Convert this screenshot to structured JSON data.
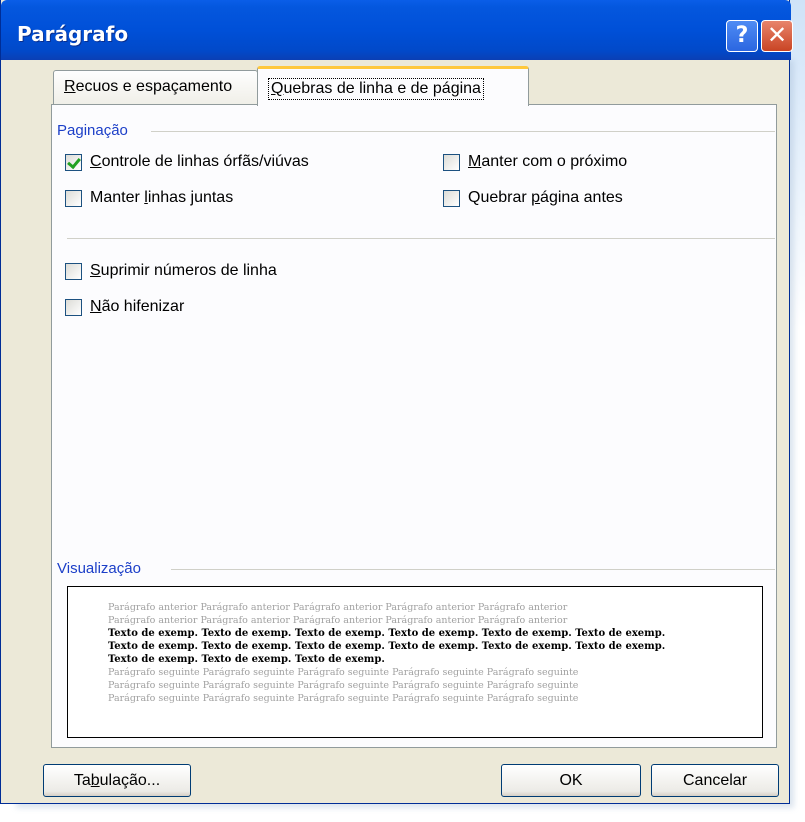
{
  "window": {
    "title": "Parágrafo",
    "help_label": "?",
    "close_label": "✕"
  },
  "tabs": [
    {
      "label_pre": "",
      "label_key": "R",
      "label_post": "ecuos e espaçamento",
      "active": false
    },
    {
      "label_pre": "",
      "label_key": "Q",
      "label_post": "uebras de linha e de página",
      "active": true
    }
  ],
  "pagination": {
    "group_label": "Paginação",
    "options": [
      {
        "pre": "",
        "key": "C",
        "post": "ontrole de linhas órfãs/viúvas",
        "checked": true
      },
      {
        "pre": "",
        "key": "M",
        "post": "anter com o próximo",
        "checked": false
      },
      {
        "pre": "Manter ",
        "key": "l",
        "post": "inhas juntas",
        "checked": false
      },
      {
        "pre": "Quebrar ",
        "key": "p",
        "post": "ágina antes",
        "checked": false
      }
    ]
  },
  "formatting": {
    "options": [
      {
        "pre": "",
        "key": "S",
        "post": "uprimir números de linha",
        "checked": false
      },
      {
        "pre": "",
        "key": "N",
        "post": "ão hifenizar",
        "checked": false
      }
    ]
  },
  "preview": {
    "group_label": "Visualização",
    "lines": [
      {
        "text": "Parágrafo anterior Parágrafo anterior Parágrafo anterior Parágrafo anterior Parágrafo anterior",
        "style": "gray"
      },
      {
        "text": "Parágrafo anterior Parágrafo anterior Parágrafo anterior Parágrafo anterior Parágrafo anterior",
        "style": "gray"
      },
      {
        "text": "Texto de exemp. Texto de exemp. Texto de exemp. Texto de exemp. Texto de exemp. Texto de exemp.",
        "style": "dark"
      },
      {
        "text": "Texto de exemp. Texto de exemp. Texto de exemp. Texto de exemp. Texto de exemp. Texto de exemp.",
        "style": "dark"
      },
      {
        "text": "Texto de exemp. Texto de exemp. Texto de exemp.",
        "style": "dark"
      },
      {
        "text": "Parágrafo seguinte Parágrafo seguinte Parágrafo seguinte Parágrafo seguinte Parágrafo seguinte",
        "style": "gray"
      },
      {
        "text": "Parágrafo seguinte Parágrafo seguinte Parágrafo seguinte Parágrafo seguinte Parágrafo seguinte",
        "style": "gray"
      },
      {
        "text": "Parágrafo seguinte Parágrafo seguinte Parágrafo seguinte Parágrafo seguinte Parágrafo seguinte",
        "style": "gray"
      }
    ]
  },
  "buttons": {
    "tabs_pre": "Ta",
    "tabs_key": "b",
    "tabs_post": "ulação...",
    "ok": "OK",
    "cancel": "Cancelar"
  }
}
